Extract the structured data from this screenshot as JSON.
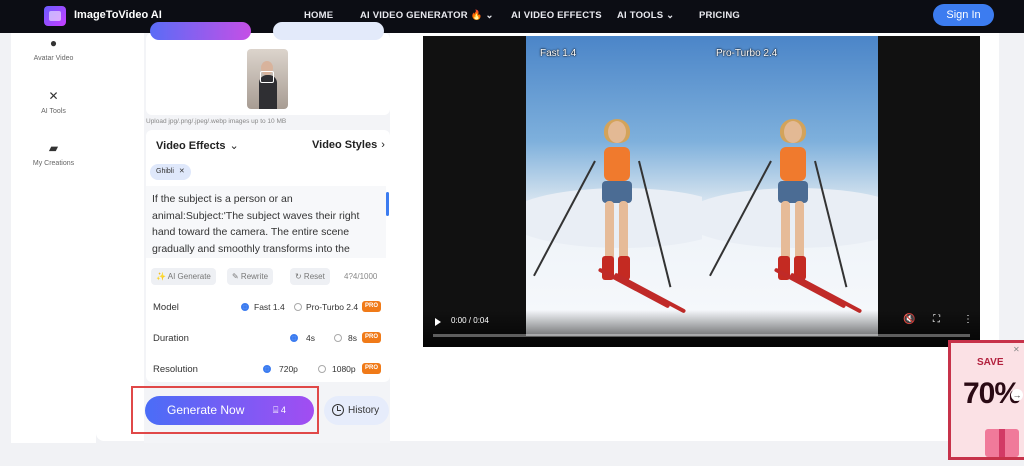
{
  "nav": {
    "brand": "ImageToVideo AI",
    "items": [
      "HOME",
      "AI VIDEO GENERATOR 🔥 ⌄",
      "AI VIDEO EFFECTS",
      "AI TOOLS ⌄",
      "PRICING"
    ],
    "signin": "Sign In"
  },
  "sidebar": {
    "items": [
      {
        "label": "Avatar Video",
        "icon": "avatar-icon"
      },
      {
        "label": "AI Tools",
        "icon": "tools-icon"
      },
      {
        "label": "My Creations",
        "icon": "folder-icon"
      }
    ]
  },
  "upload": {
    "note": "Upload jpg/.png/.jpeg/.webp images up to 10 MB"
  },
  "effects": {
    "video_effects_label": "Video Effects",
    "video_styles_label": "Video Styles",
    "selected_tag": "Ghibli",
    "tag_close": "✕",
    "prompt": "If the subject is a person or an animal:Subject:'The subject waves their right hand toward the camera. The entire scene gradually and smoothly transforms into the"
  },
  "prompt_tools": {
    "ai_generate": "✨ AI Generate",
    "rewrite": "✎ Rewrite",
    "reset": "↻ Reset",
    "counter": "4?4/1000"
  },
  "options": {
    "model": {
      "label": "Model",
      "opt1": "Fast 1.4",
      "opt2": "Pro-Turbo 2.4"
    },
    "duration": {
      "label": "Duration",
      "opt1": "4s",
      "opt2": "8s"
    },
    "resolution": {
      "label": "Resolution",
      "opt1": "720p",
      "opt2": "1080p"
    },
    "pro_badge": "PRO"
  },
  "actions": {
    "generate": "Generate Now",
    "credits": "⌸ 4",
    "history": "History"
  },
  "player": {
    "label_left": "Fast 1.4",
    "label_right": "Pro-Turbo 2.4",
    "time": "0:00 / 0:04",
    "progress": 0
  },
  "promo": {
    "save": "SAVE",
    "percent": "70%",
    "arrow": "→"
  }
}
